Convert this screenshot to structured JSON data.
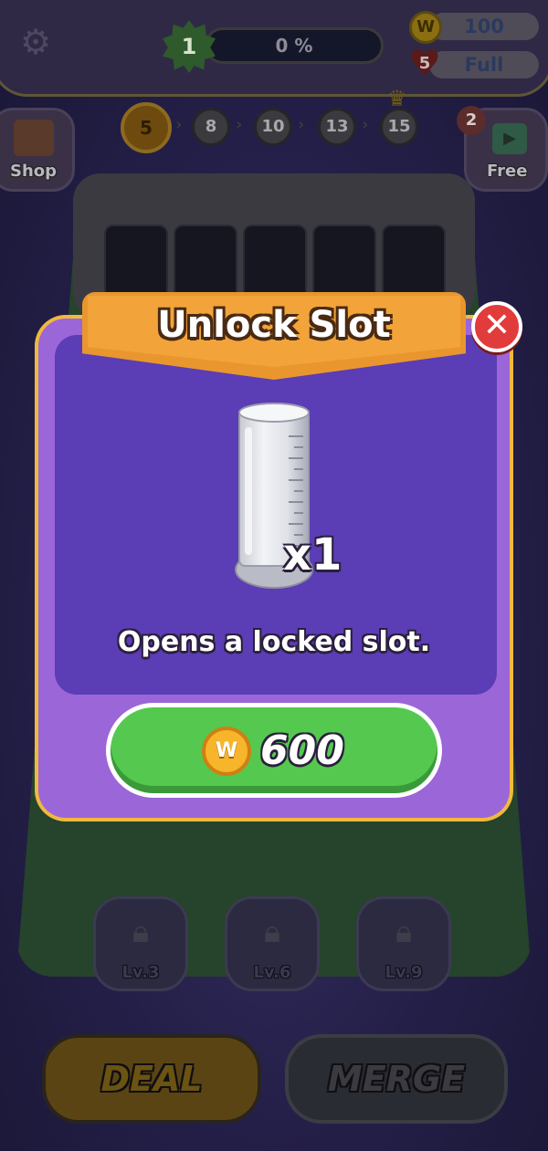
{
  "header": {
    "level": "1",
    "progress_text": "0 %",
    "progress_value": 0,
    "coins": "100",
    "lives_count": "5",
    "lives_status": "Full",
    "coin_symbol": "W"
  },
  "stages": {
    "current": "5",
    "items": [
      "8",
      "10",
      "13",
      "15"
    ]
  },
  "side": {
    "shop_label": "Shop",
    "free_label": "Free",
    "free_badge": "2"
  },
  "locks": [
    {
      "label": "Lv.3"
    },
    {
      "label": "Lv.6"
    },
    {
      "label": "Lv.9"
    }
  ],
  "bottom": {
    "deal_label": "DEAL",
    "merge_label": "MERGE"
  },
  "modal": {
    "title": "Unlock Slot",
    "close_symbol": "✕",
    "item_quantity": "x1",
    "description": "Opens a locked slot.",
    "price": "600",
    "price_coin_symbol": "W"
  },
  "colors": {
    "modal_border": "#f0b93e",
    "modal_fill": "#9b66d8",
    "modal_inner": "#5b3db5",
    "ribbon": "#f2a43a",
    "buy_green": "#55c84f",
    "close_red": "#e23b3b"
  }
}
